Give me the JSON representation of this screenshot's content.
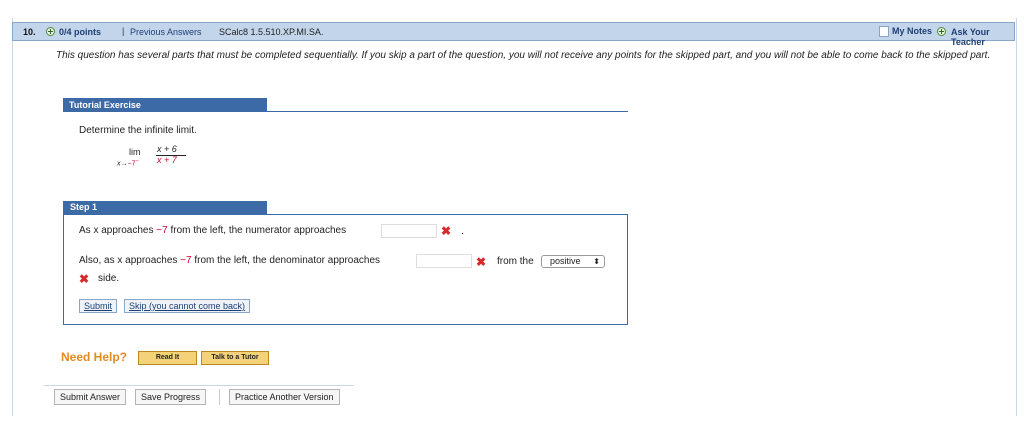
{
  "question": {
    "number": "10.",
    "points": "0/4 points",
    "separator": "|",
    "previous_answers": "Previous Answers",
    "source": "SCalc8 1.5.510.XP.MI.SA.",
    "my_notes": "My Notes",
    "ask_teacher": "Ask Your Teacher"
  },
  "intro_text": "This question has several parts that must be completed sequentially. If you skip a part of the question, you will not receive any points for the skipped part, and you will not be able to come back to the skipped part.",
  "tutorial": {
    "title": "Tutorial Exercise",
    "prompt": "Determine the infinite limit.",
    "limit": {
      "lim": "lim",
      "sub_var": "x",
      "sub_arrow": "→",
      "sub_value": "−7",
      "sub_side": "−",
      "numerator": "x + 6",
      "denominator": "x + 7"
    }
  },
  "step": {
    "title": "Step 1",
    "line1_a": "As x approaches",
    "line1_val": "−7",
    "line1_b": "from the left, the numerator approaches",
    "line1_end": ".",
    "line2_a": "Also, as x approaches",
    "line2_val": "−7",
    "line2_b": "from the left, the denominator approaches",
    "line2_c": "from the",
    "side_select": "positive",
    "side_text": "side.",
    "submit": "Submit",
    "skip": "Skip (you cannot come back)"
  },
  "help": {
    "label": "Need Help?",
    "read_it": "Read It",
    "talk_tutor": "Talk to a Tutor"
  },
  "bottom": {
    "submit_answer": "Submit Answer",
    "save_progress": "Save Progress",
    "practice": "Practice Another Version"
  },
  "colors": {
    "header_bg": "#c3d5ea",
    "tutorial_blue": "#3c6aa6",
    "error_red": "#d62b2b",
    "help_orange": "#e58a1f"
  }
}
